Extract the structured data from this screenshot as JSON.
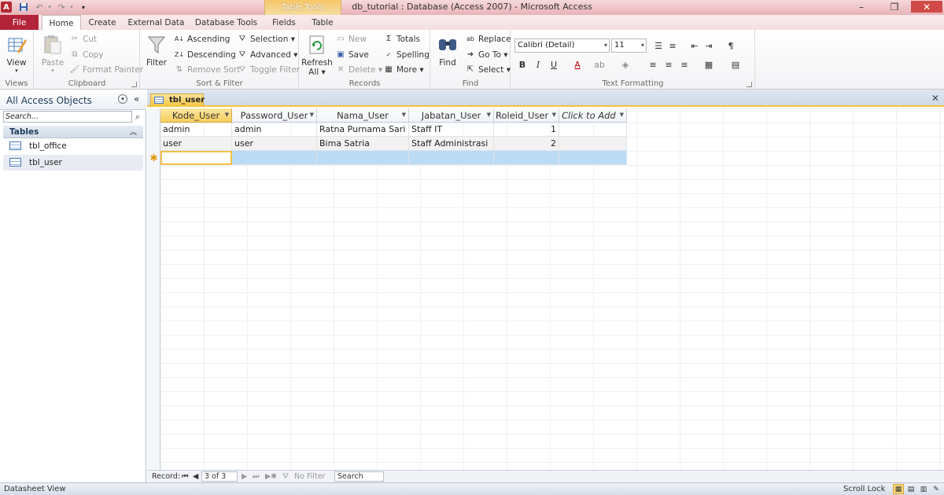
{
  "window": {
    "title": "db_tutorial : Database (Access 2007)  -  Microsoft Access",
    "app_icon": "A",
    "min": "–",
    "max": "❐",
    "close": "✕"
  },
  "contextual_tab": "Table Tools",
  "tabs": {
    "file": "File",
    "home": "Home",
    "create": "Create",
    "external": "External Data",
    "dbtools": "Database Tools",
    "fields": "Fields",
    "table": "Table"
  },
  "ribbon": {
    "views": {
      "label": "Views",
      "view": "View"
    },
    "clipboard": {
      "label": "Clipboard",
      "paste": "Paste",
      "cut": "Cut",
      "copy": "Copy",
      "format_painter": "Format Painter"
    },
    "sort_filter": {
      "label": "Sort & Filter",
      "filter": "Filter",
      "ascending": "Ascending",
      "descending": "Descending",
      "remove_sort": "Remove Sort",
      "selection": "Selection ▾",
      "advanced": "Advanced ▾",
      "toggle_filter": "Toggle Filter"
    },
    "records": {
      "label": "Records",
      "refresh": "Refresh",
      "refresh_all": "All ▾",
      "new": "New",
      "save": "Save",
      "delete": "Delete ▾",
      "totals": "Totals",
      "spelling": "Spelling",
      "more": "More ▾"
    },
    "find": {
      "label": "Find",
      "find": "Find",
      "replace": "Replace",
      "goto": "Go To ▾",
      "select": "Select ▾"
    },
    "text_formatting": {
      "label": "Text Formatting",
      "font": "Calibri (Detail)",
      "size": "11"
    }
  },
  "nav": {
    "title": "All Access Objects",
    "search_placeholder": "Search...",
    "section": "Tables",
    "items": [
      {
        "label": "tbl_office"
      },
      {
        "label": "tbl_user"
      }
    ]
  },
  "document": {
    "tab_label": "tbl_user",
    "columns": [
      "Kode_User",
      "Password_User",
      "Nama_User",
      "Jabatan_User",
      "Roleid_User",
      "Click to Add"
    ],
    "rows": [
      [
        "admin",
        "admin",
        "Ratna Purnama Sari",
        "Staff IT",
        "1"
      ],
      [
        "user",
        "user",
        "Bima Satria",
        "Staff Administrasi",
        "2"
      ]
    ],
    "new_row_marker": "✱"
  },
  "record_nav": {
    "label": "Record:",
    "position": "3 of 3",
    "filter": "No Filter",
    "search": "Search"
  },
  "status": {
    "left": "Datasheet View",
    "right": "Scroll Lock"
  }
}
